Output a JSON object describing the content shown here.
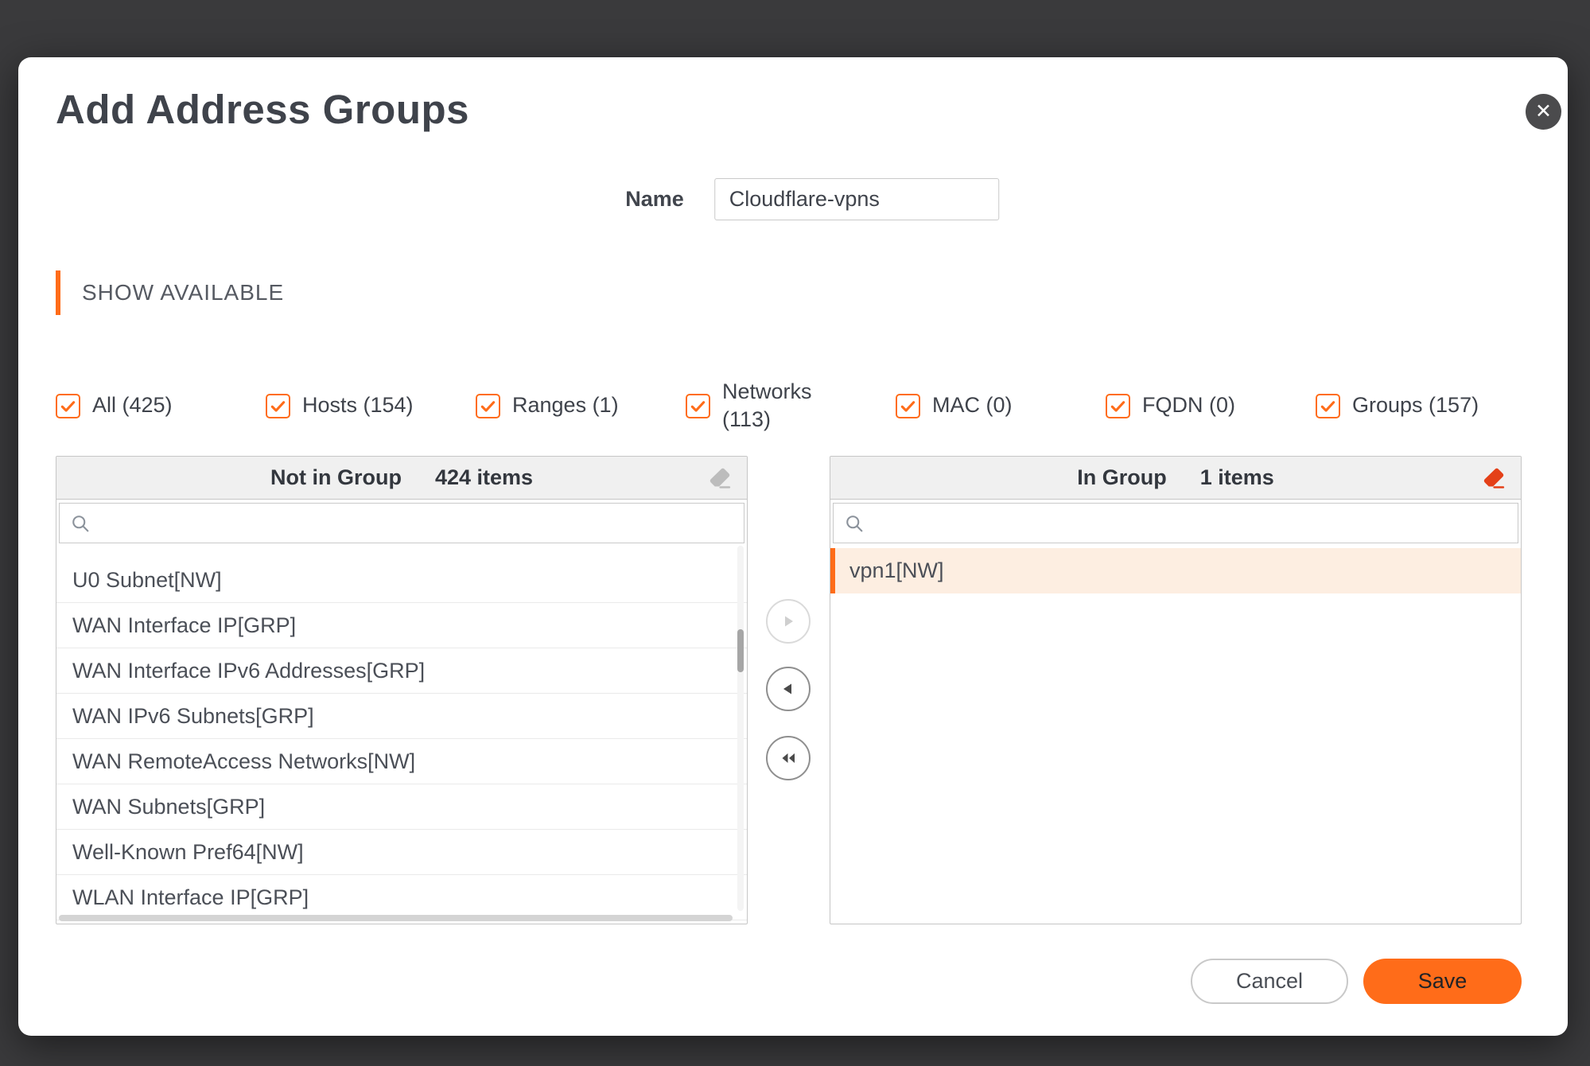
{
  "colors": {
    "accent": "#ff6c19",
    "overlay": "#3a3a3c",
    "selected-bg": "#fdeee1",
    "eraser-active": "#e44018",
    "eraser-disabled": "#bcbcbc"
  },
  "dialog": {
    "title": "Add Address Groups"
  },
  "icons": {
    "close": "✕"
  },
  "name_field": {
    "label": "Name",
    "value": "Cloudflare-vpns"
  },
  "section": {
    "title": "SHOW AVAILABLE"
  },
  "filters": [
    {
      "label": "All (425)",
      "checked": true
    },
    {
      "label": "Hosts (154)",
      "checked": true
    },
    {
      "label": "Ranges (1)",
      "checked": true
    },
    {
      "label": "Networks (113)",
      "checked": true
    },
    {
      "label": "MAC (0)",
      "checked": true
    },
    {
      "label": "FQDN (0)",
      "checked": true
    },
    {
      "label": "Groups (157)",
      "checked": true
    }
  ],
  "left_panel": {
    "title": "Not in Group",
    "count": "424 items",
    "search_value": "",
    "items": [
      "U0 Subnet[NW]",
      "WAN Interface IP[GRP]",
      "WAN Interface IPv6 Addresses[GRP]",
      "WAN IPv6 Subnets[GRP]",
      "WAN RemoteAccess Networks[NW]",
      "WAN Subnets[GRP]",
      "Well-Known Pref64[NW]",
      "WLAN Interface IP[GRP]"
    ]
  },
  "right_panel": {
    "title": "In Group",
    "count": "1 items",
    "search_value": "",
    "items": [
      "vpn1[NW]"
    ]
  },
  "actions": {
    "cancel": "Cancel",
    "save": "Save"
  }
}
